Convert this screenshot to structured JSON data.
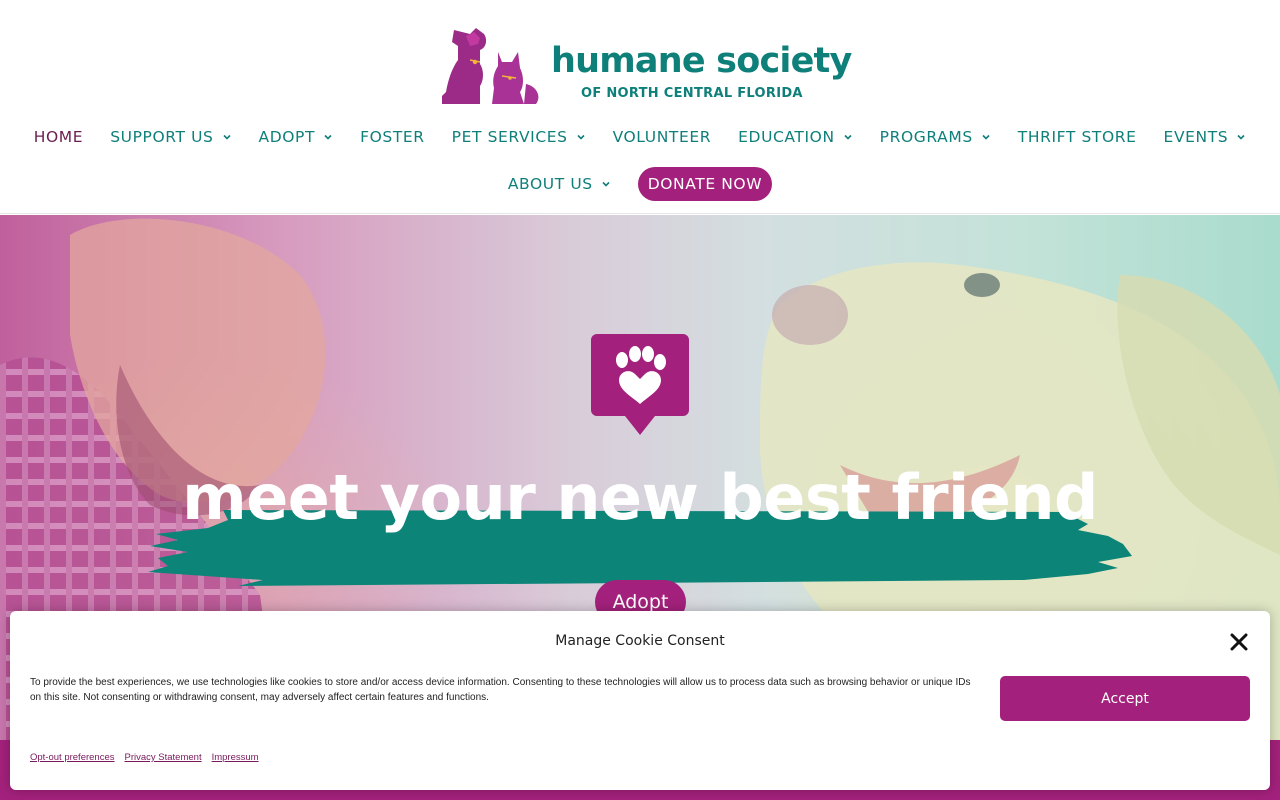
{
  "header": {
    "logo": {
      "title": "humane society",
      "subtitle": "OF NORTH CENTRAL FLORIDA"
    },
    "nav": {
      "row1": [
        {
          "label": "HOME",
          "active": true,
          "dropdown": false
        },
        {
          "label": "SUPPORT US",
          "dropdown": true
        },
        {
          "label": "ADOPT",
          "dropdown": true
        },
        {
          "label": "FOSTER",
          "dropdown": false
        },
        {
          "label": "PET SERVICES",
          "dropdown": true
        },
        {
          "label": "VOLUNTEER",
          "dropdown": false
        },
        {
          "label": "EDUCATION",
          "dropdown": true
        },
        {
          "label": "PROGRAMS",
          "dropdown": true
        },
        {
          "label": "THRIFT STORE",
          "dropdown": false
        },
        {
          "label": "EVENTS",
          "dropdown": true
        }
      ],
      "row2": [
        {
          "label": "ABOUT US",
          "dropdown": true
        }
      ],
      "donate_label": "DONATE NOW"
    }
  },
  "hero": {
    "heading": "meet your new best friend",
    "button_label": "Adopt",
    "badge_icon": "paw-heart-icon"
  },
  "cookie": {
    "title": "Manage Cookie Consent",
    "text": "To provide the best experiences, we use technologies like cookies to store and/or access device information. Consenting to these technologies will allow us to process data such as browsing behavior or unique IDs on this site. Not consenting or withdrawing consent, may adversely affect certain features and functions.",
    "accept_label": "Accept",
    "links": [
      "Opt-out preferences",
      "Privacy Statement",
      "Impressum"
    ]
  },
  "colors": {
    "teal": "#0f7f7a",
    "magenta": "#a3217c",
    "active_nav": "#6b1d4f"
  }
}
